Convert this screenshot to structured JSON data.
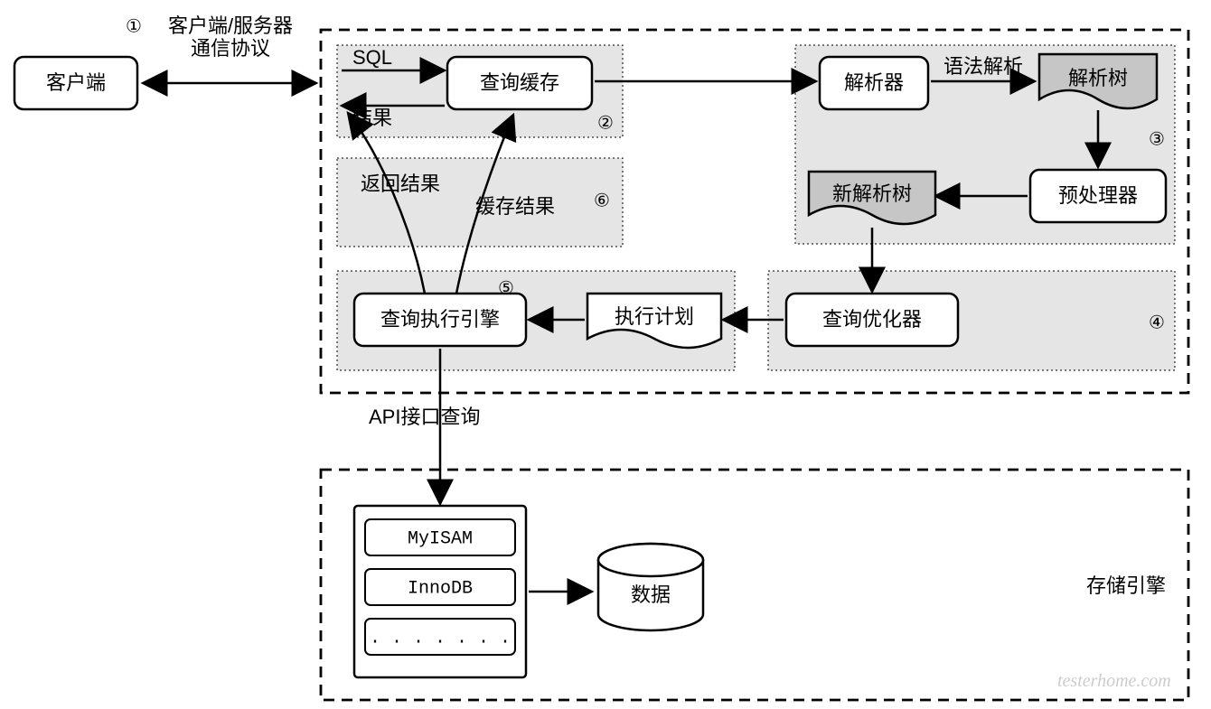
{
  "nodes": {
    "client": "客户端",
    "query_cache": "查询缓存",
    "parser": "解析器",
    "parse_tree": "解析树",
    "preprocessor": "预处理器",
    "new_parse_tree": "新解析树",
    "query_optimizer": "查询优化器",
    "exec_plan": "执行计划",
    "exec_engine": "查询执行引擎",
    "data": "数据",
    "storage_engine_title": "存储引擎"
  },
  "engines": {
    "e1": "MyISAM",
    "e2": "InnoDB",
    "e3": ". . . . . . ."
  },
  "edges": {
    "client_protocol_l1": "客户端/服务器",
    "client_protocol_l2": "通信协议",
    "sql": "SQL",
    "result": "结果",
    "return_result": "返回结果",
    "cache_result": "缓存结果",
    "syntax_parse": "语法解析",
    "api_query": "API接口查询"
  },
  "markers": {
    "m1": "①",
    "m2": "②",
    "m3": "③",
    "m4": "④",
    "m5": "⑤",
    "m6": "⑥"
  },
  "watermark": "testerhome.com"
}
